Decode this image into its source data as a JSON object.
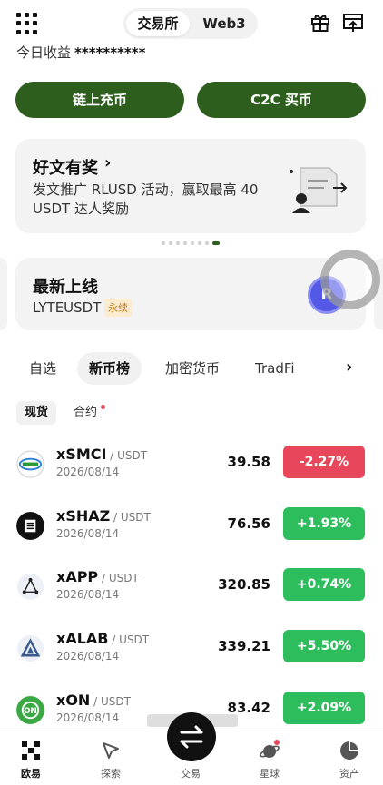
{
  "header": {
    "tabs": [
      "交易所",
      "Web3"
    ],
    "earnings_label": "今日收益",
    "earnings_value": "**********"
  },
  "actions": {
    "deposit": "链上充币",
    "c2c": "C2C 买币"
  },
  "promo": {
    "title": "好文有奖",
    "desc": "发文推广 RLUSD 活动，赢取最高 40 USDT 达人奖励"
  },
  "listing": {
    "title": "最新上线",
    "symbol": "LYTEUSDT",
    "badge": "永续",
    "coin_letter": "R"
  },
  "categories": [
    "自选",
    "新币榜",
    "加密货币",
    "TradFi"
  ],
  "subtabs": [
    "现货",
    "合约"
  ],
  "rows": [
    {
      "name": "xSMCI",
      "quote": " / USDT",
      "date": "2026/08/14",
      "price": "39.58",
      "change": "-2.27%",
      "dir": "down"
    },
    {
      "name": "xSHAZ",
      "quote": " / USDT",
      "date": "2026/08/14",
      "price": "76.56",
      "change": "+1.93%",
      "dir": "up"
    },
    {
      "name": "xAPP",
      "quote": " / USDT",
      "date": "2026/08/14",
      "price": "320.85",
      "change": "+0.74%",
      "dir": "up"
    },
    {
      "name": "xALAB",
      "quote": " / USDT",
      "date": "2026/08/14",
      "price": "339.21",
      "change": "+5.50%",
      "dir": "up"
    },
    {
      "name": "xON",
      "quote": " / USDT",
      "date": "2026/08/14",
      "price": "83.42",
      "change": "+2.09%",
      "dir": "up"
    }
  ],
  "nav": [
    "欧易",
    "探索",
    "交易",
    "星球",
    "资产"
  ],
  "colors": {
    "brand": "#2d5e1e",
    "up": "#2ebd5d",
    "down": "#e8475b"
  }
}
